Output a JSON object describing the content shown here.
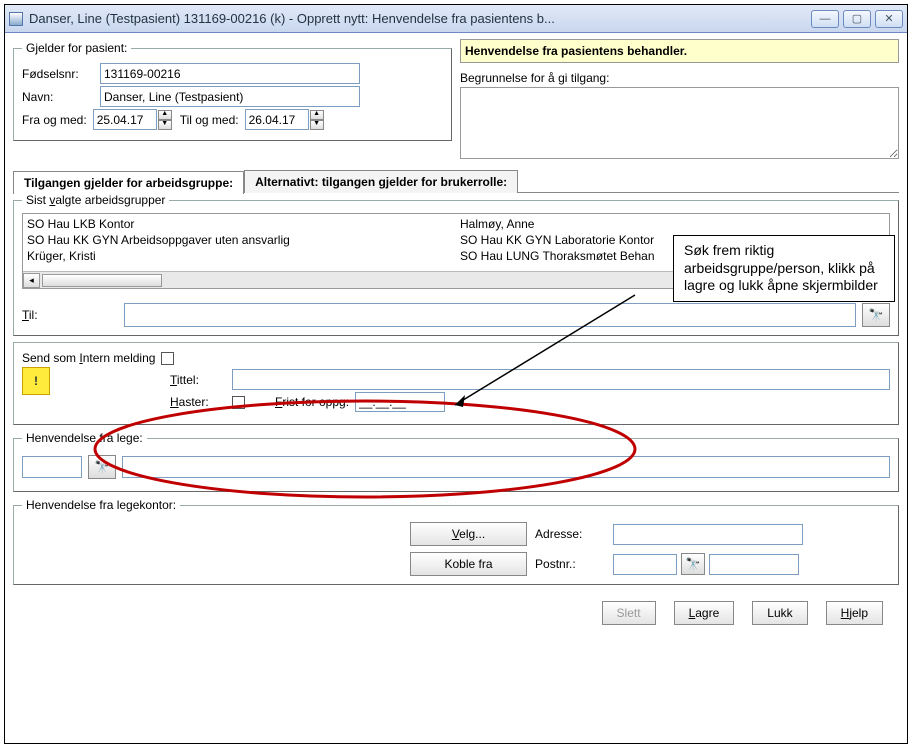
{
  "window": {
    "title": "Danser, Line (Testpasient)  131169-00216 (k) - Opprett nytt: Henvendelse fra pasientens b...",
    "min": "—",
    "max": "▢",
    "close": "✕"
  },
  "patient": {
    "legend": "Gjelder for pasient:",
    "fodselsnr_label": "Fødselsnr:",
    "fodselsnr": "131169-00216",
    "navn_label": "Navn:",
    "navn": "Danser, Line (Testpasient)",
    "fra_label": "Fra og med:",
    "fra": "25.04.17",
    "til_label": "Til og med:",
    "til": "26.04.17"
  },
  "right_panel": {
    "header": "Henvendelse fra pasientens behandler.",
    "reason_label": "Begrunnelse for å gi tilgang:"
  },
  "tabs": {
    "t1": "Tilgangen gjelder for arbeidsgruppe:",
    "t2": "Alternativt: tilgangen gjelder for brukerrolle:"
  },
  "recent": {
    "legend": "Sist valgte arbeidsgrupper",
    "col1": [
      "SO Hau LKB Kontor",
      "SO Hau KK GYN Arbeidsoppgaver uten ansvarlig",
      "Krüger, Kristi"
    ],
    "col2": [
      "Halmøy, Anne",
      "SO Hau KK GYN Laboratorie Kontor",
      "SO Hau LUNG Thoraksmøtet Behan"
    ]
  },
  "til": {
    "label": "Til:"
  },
  "msg": {
    "send_intern": "Send som Intern melding",
    "tittel": "Tittel:",
    "haster": "Haster:",
    "frist": "Frist for oppg:",
    "frist_mask": "__.__.__"
  },
  "lege": {
    "legend": "Henvendelse fra lege:"
  },
  "kontor": {
    "legend": "Henvendelse fra legekontor:",
    "velg": "Velg...",
    "koble": "Koble fra",
    "adresse": "Adresse:",
    "postnr": "Postnr.:"
  },
  "buttons": {
    "slett": "Slett",
    "lagre": "Lagre",
    "lukk": "Lukk",
    "hjelp": "Hjelp"
  },
  "annotation": "Søk frem riktig arbeidsgruppe/person, klikk på lagre og lukk åpne skjermbilder",
  "icons": {
    "binocular": "🔭",
    "note": "!"
  }
}
